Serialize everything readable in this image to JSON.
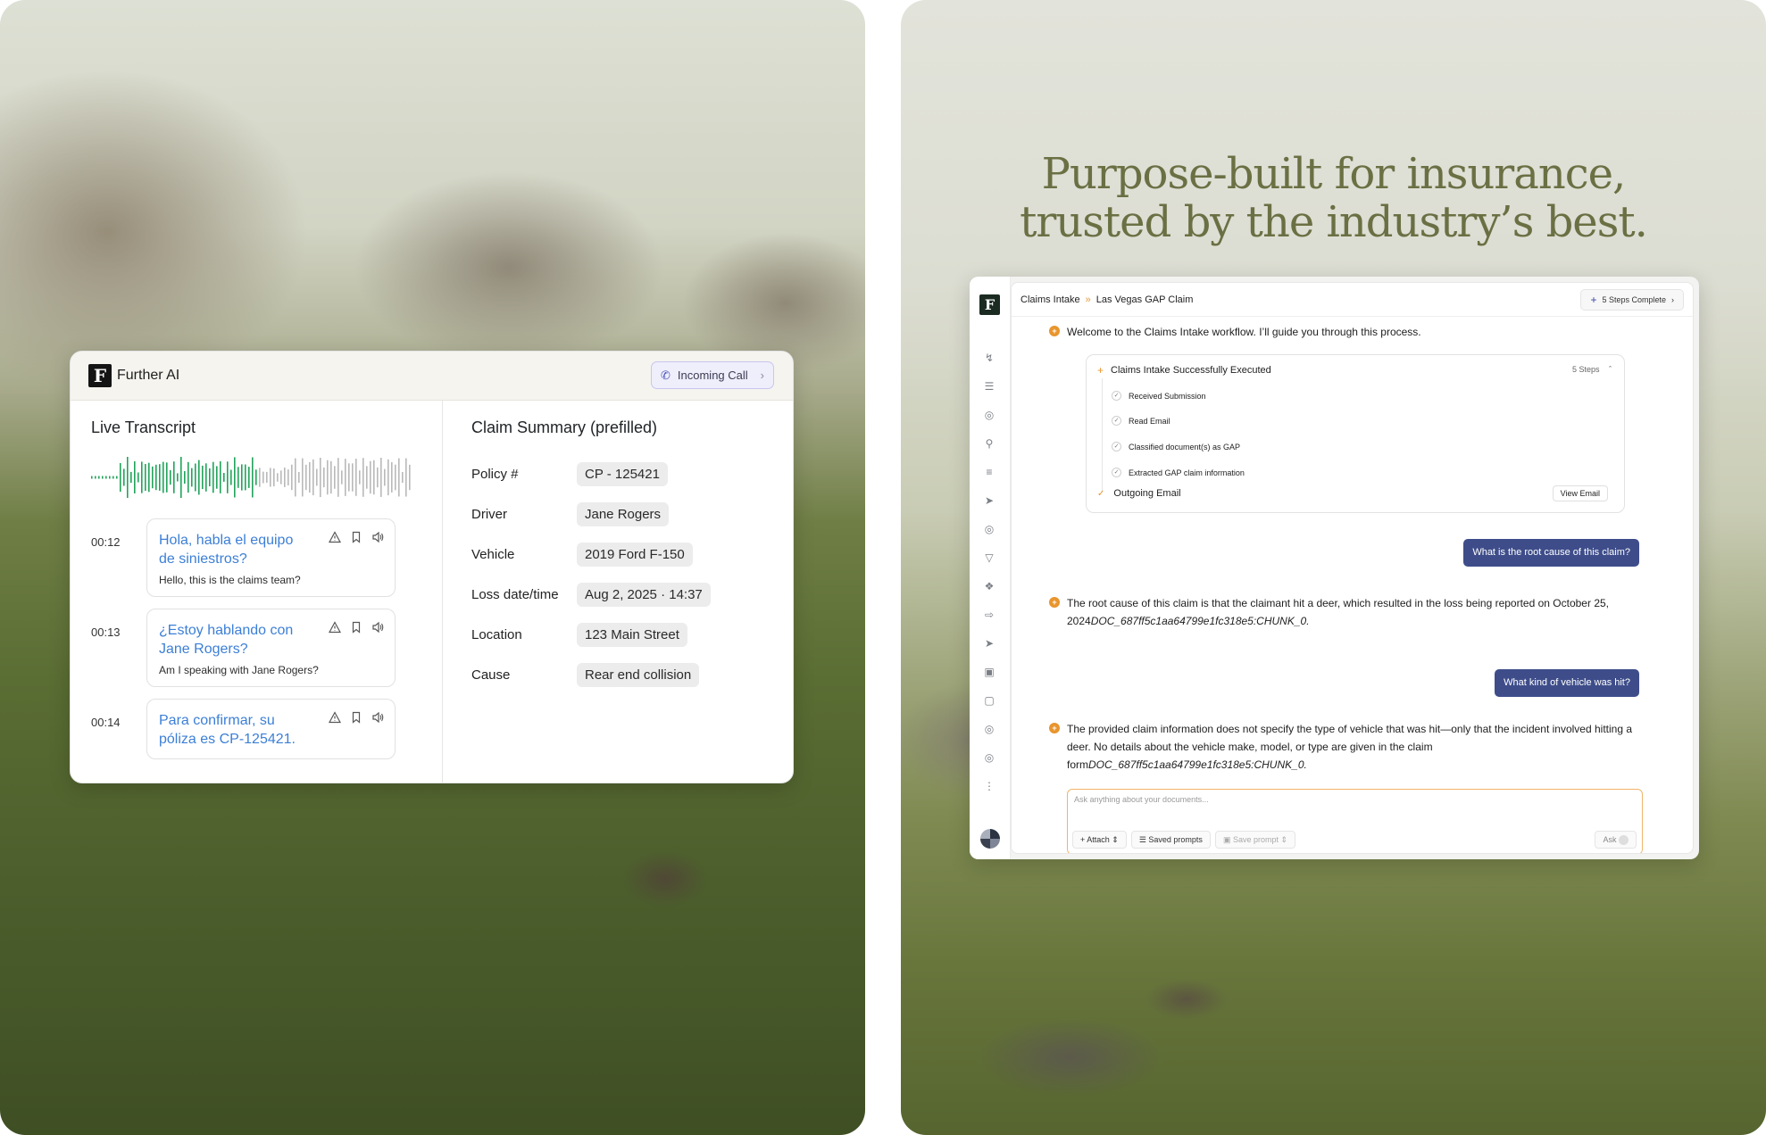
{
  "headline": {
    "line1": "Purpose-built for insurance,",
    "line2": "trusted by the industry’s best."
  },
  "left_app": {
    "brand": "Further AI",
    "incoming_call": "Incoming Call",
    "transcript_title": "Live Transcript",
    "entries": [
      {
        "time": "00:12",
        "spanish": "Hola, habla el equipo de siniestros?",
        "english": "Hello, this is the claims team?"
      },
      {
        "time": "00:13",
        "spanish": "¿Estoy hablando con Jane Rogers?",
        "english": "Am I speaking with Jane Rogers?"
      },
      {
        "time": "00:14",
        "spanish": "Para confirmar, su póliza es CP-125421.",
        "english": ""
      }
    ],
    "summary_title": "Claim Summary (prefilled)",
    "summary": [
      {
        "label": "Policy #",
        "value": "CP - 125421"
      },
      {
        "label": "Driver",
        "value": "Jane Rogers"
      },
      {
        "label": "Vehicle",
        "value": "2019 Ford F-150"
      },
      {
        "label": "Loss date/time",
        "value": "Aug 2, 2025 · 14:37"
      },
      {
        "label": "Location",
        "value": "123 Main Street"
      },
      {
        "label": "Cause",
        "value": "Rear end collision"
      }
    ],
    "accent_color": "#22a35a"
  },
  "right_app": {
    "logo": "F",
    "breadcrumb": [
      "Claims Intake",
      "Las Vegas GAP Claim"
    ],
    "steps_complete": "5 Steps Complete",
    "welcome": "Welcome to the Claims Intake workflow. I’ll guide you through this process.",
    "steps_card": {
      "title": "Claims Intake Successfully Executed",
      "count": "5 Steps",
      "items": [
        "Received Submission",
        "Read Email",
        "Classified document(s) as GAP",
        "Extracted GAP claim information"
      ],
      "outgoing": "Outgoing Email",
      "view_email": "View Email"
    },
    "q1": "What is the root cause of this claim?",
    "a1_text": "The root cause of this claim is that the claimant hit a deer, which resulted in the loss being reported on October 25, 2024",
    "a1_doc": "DOC_687ff5c1aa64799e1fc318e5:CHUNK_0.",
    "q2": "What kind of vehicle was hit?",
    "a2_text": "The provided claim information does not specify the type of vehicle that was hit—only that the incident involved hitting a deer. No details about the vehicle make, model, or type are given in the claim form",
    "a2_doc": "DOC_687ff5c1aa64799e1fc318e5:CHUNK_0.",
    "input_placeholder": "Ask anything about your documents...",
    "attach": "Attach",
    "saved_prompts": "Saved prompts",
    "save_prompt": "Save prompt",
    "ask": "Ask",
    "accent_color": "#3e4d8a"
  }
}
